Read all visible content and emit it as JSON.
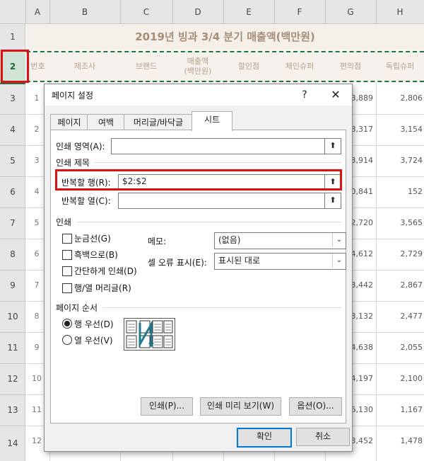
{
  "spreadsheet": {
    "columns": [
      "A",
      "B",
      "C",
      "D",
      "E",
      "F",
      "G",
      "H"
    ],
    "rows": [
      "1",
      "2",
      "3",
      "4",
      "5",
      "6",
      "7",
      "8",
      "9",
      "10",
      "11",
      "12",
      "13",
      "14"
    ],
    "title": "2019년 빙과 3/4 분기 매출액(백만원)",
    "headers": [
      "번호",
      "제조사",
      "브랜드",
      "매출액\n(백만원)",
      "할인점",
      "체인슈퍼",
      "편의점",
      "독립슈퍼"
    ],
    "row_numbers": [
      "1",
      "2",
      "3",
      "4",
      "5",
      "6",
      "7",
      "8",
      "9",
      "10",
      "11",
      "12"
    ],
    "g_values": [
      "8,889",
      "8,317",
      "3,914",
      "10,841",
      "2,720",
      "4,612",
      "3,442",
      "3,132",
      "4,638",
      "4,197",
      "6,130",
      "3,452"
    ],
    "h_values": [
      "2,806",
      "3,154",
      "3,724",
      "152",
      "3,565",
      "2,729",
      "2,867",
      "2,477",
      "2,055",
      "2,100",
      "1,167",
      "1,478"
    ]
  },
  "dialog": {
    "title": "페이지 설정",
    "help": "?",
    "close": "✕",
    "tabs": [
      "페이지",
      "여백",
      "머리글/바닥글",
      "시트"
    ],
    "print_area_label": "인쇄 영역(A):",
    "print_area_value": "",
    "print_titles_section": "인쇄 제목",
    "repeat_rows_label": "반복할 행(R):",
    "repeat_rows_value": "$2:$2",
    "repeat_cols_label": "반복할 열(C):",
    "repeat_cols_value": "",
    "print_section": "인쇄",
    "gridlines": "눈금선(G)",
    "black_white": "흑백으로(B)",
    "draft": "간단하게 인쇄(D)",
    "headings": "행/열 머리글(R)",
    "comments_label": "메모:",
    "comments_value": "(없음)",
    "errors_label": "셀 오류 표시(E):",
    "errors_value": "표시된 대로",
    "page_order_section": "페이지 순서",
    "down_then_over": "행 우선(D)",
    "over_then_down": "열 우선(V)",
    "print_btn": "인쇄(P)...",
    "preview_btn": "인쇄 미리 보기(W)",
    "options_btn": "옵션(O)...",
    "ok_btn": "확인",
    "cancel_btn": "취소"
  },
  "colors": {
    "highlight": "#e01010",
    "copy_marquee": "#217346",
    "title_text": "#a88e76",
    "focus": "#0078d7"
  }
}
